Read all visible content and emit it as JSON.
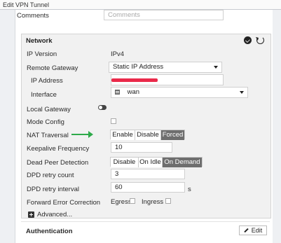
{
  "window": {
    "title": "Edit VPN Tunnel"
  },
  "comments": {
    "label": "Comments",
    "placeholder": "Comments"
  },
  "network": {
    "title": "Network",
    "ip_version": {
      "label": "IP Version",
      "value": "IPv4"
    },
    "remote_gateway": {
      "label": "Remote Gateway",
      "value": "Static IP Address"
    },
    "ip_address": {
      "label": "IP Address",
      "value_redacted": true
    },
    "interface": {
      "label": "Interface",
      "value": "wan"
    },
    "local_gateway": {
      "label": "Local Gateway",
      "enabled": false
    },
    "mode_config": {
      "label": "Mode Config",
      "checked": false
    },
    "nat_traversal": {
      "label": "NAT Traversal",
      "options": [
        "Enable",
        "Disable",
        "Forced"
      ],
      "selected": "Forced"
    },
    "keepalive": {
      "label": "Keepalive Frequency",
      "value": "10"
    },
    "dpd": {
      "label": "Dead Peer Detection",
      "options": [
        "Disable",
        "On Idle",
        "On Demand"
      ],
      "selected": "On Demand"
    },
    "dpd_retry_count": {
      "label": "DPD retry count",
      "value": "3"
    },
    "dpd_retry_interval": {
      "label": "DPD retry interval",
      "value": "60",
      "unit": "s"
    },
    "fec": {
      "label": "Forward Error Correction",
      "egress_label": "Egress",
      "ingress_label": "Ingress",
      "egress": false,
      "ingress": false
    },
    "advanced": {
      "label": "Advanced..."
    }
  },
  "authentication": {
    "label": "Authentication",
    "edit_label": "Edit"
  },
  "colors": {
    "annotation_arrow": "#2eaa4a",
    "selected_segment": "#6e6e6e",
    "redaction": "#ea2a4a"
  },
  "icons": [
    "check-circle-icon",
    "revert-icon",
    "interface-icon",
    "plus-icon",
    "pencil-icon",
    "annotation-arrow-icon"
  ]
}
